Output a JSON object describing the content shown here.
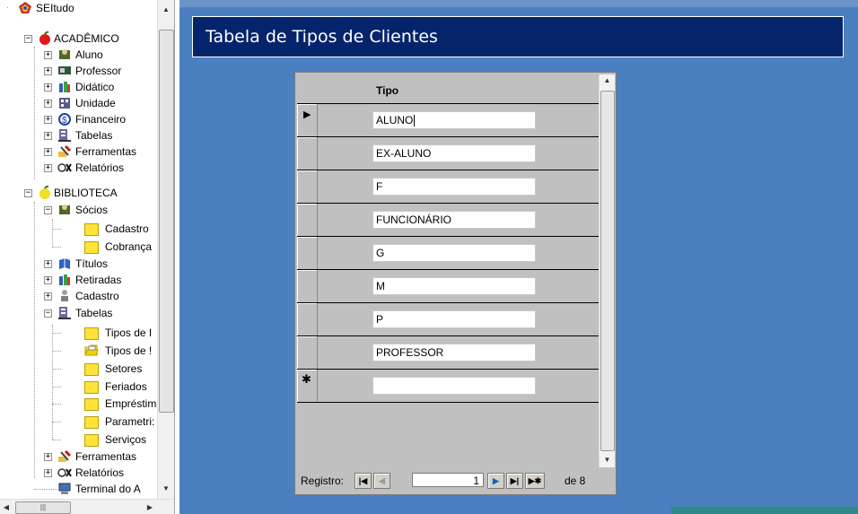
{
  "tree": {
    "root": "SEItudo",
    "items": [
      {
        "label": "ACADÊMICO"
      },
      {
        "label": "Aluno"
      },
      {
        "label": "Professor"
      },
      {
        "label": "Didático"
      },
      {
        "label": "Unidade"
      },
      {
        "label": "Financeiro"
      },
      {
        "label": "Tabelas"
      },
      {
        "label": "Ferramentas"
      },
      {
        "label": "Relatórios"
      },
      {
        "label": "BIBLIOTECA"
      },
      {
        "label": "Sócios"
      },
      {
        "label": "Cadastro"
      },
      {
        "label": "Cobrança"
      },
      {
        "label": "Títulos"
      },
      {
        "label": "Retiradas"
      },
      {
        "label": "Cadastro"
      },
      {
        "label": "Tabelas"
      },
      {
        "label": "Tipos de I"
      },
      {
        "label": "Tipos de !"
      },
      {
        "label": "Setores"
      },
      {
        "label": "Feriados"
      },
      {
        "label": "Empréstim"
      },
      {
        "label": "Parametri:"
      },
      {
        "label": "Serviços"
      },
      {
        "label": "Ferramentas"
      },
      {
        "label": "Relatórios"
      },
      {
        "label": "Terminal do A"
      }
    ]
  },
  "window": {
    "title": "Tabela de Tipos de Clientes"
  },
  "grid": {
    "column_header": "Tipo",
    "rows": [
      "ALUNO",
      "EX-ALUNO",
      "F",
      "FUNCIONÁRIO",
      "G",
      "M",
      "P",
      "PROFESSOR",
      ""
    ],
    "current_marker": "▶",
    "new_marker": "✱"
  },
  "navigation": {
    "label": "Registro:",
    "current": "1",
    "of_label": "de 8"
  },
  "colors": {
    "workspace": "#4a80c0",
    "title_bar": "#06246b",
    "form_bg": "#c0c0c0"
  }
}
